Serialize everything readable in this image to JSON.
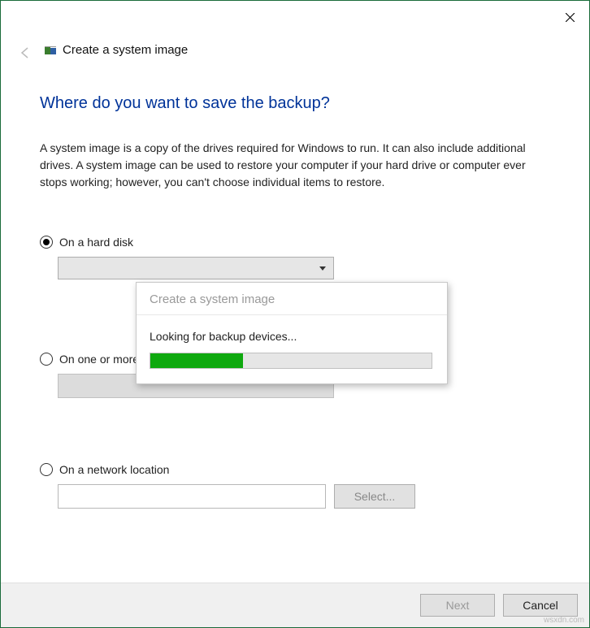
{
  "window": {
    "title": "Create a system image"
  },
  "page": {
    "heading": "Where do you want to save the backup?",
    "description": "A system image is a copy of the drives required for Windows to run. It can also include additional drives. A system image can be used to restore your computer if your hard drive or computer ever stops working; however, you can't choose individual items to restore."
  },
  "options": {
    "hard_disk": {
      "label": "On a hard disk",
      "selected": true,
      "value": ""
    },
    "dvd": {
      "label": "On one or more",
      "selected": false
    },
    "network": {
      "label": "On a network location",
      "selected": false,
      "value": "",
      "select_button": "Select..."
    }
  },
  "dialog": {
    "title": "Create a system image",
    "status": "Looking for backup devices...",
    "progress_percent": 33
  },
  "footer": {
    "next": "Next",
    "cancel": "Cancel"
  },
  "watermark": "wsxdn.com"
}
